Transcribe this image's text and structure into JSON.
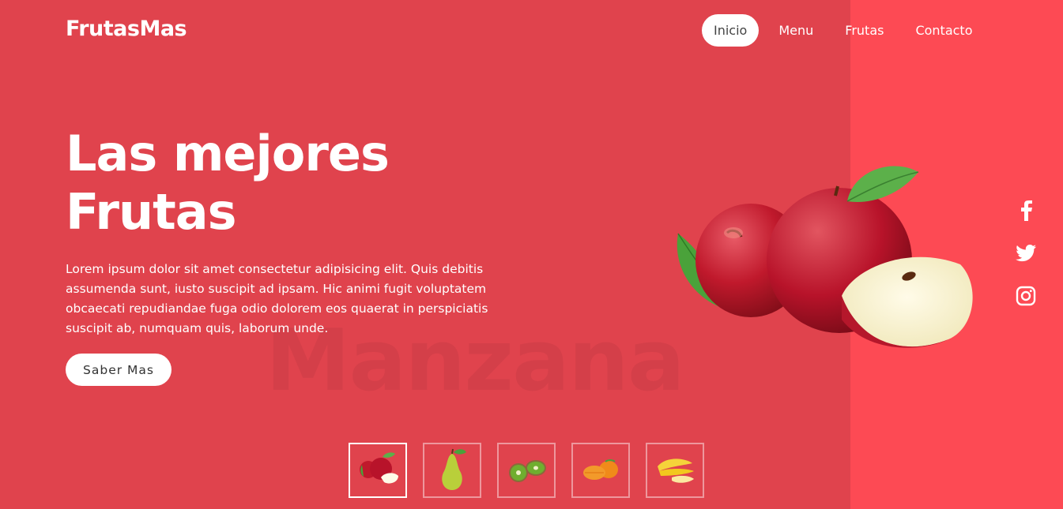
{
  "brand": {
    "logo_text": "FrutasMas"
  },
  "nav": {
    "items": [
      {
        "label": "Inicio",
        "active": true
      },
      {
        "label": "Menu",
        "active": false
      },
      {
        "label": "Frutas",
        "active": false
      },
      {
        "label": "Contacto",
        "active": false
      }
    ]
  },
  "hero": {
    "title_line1": "Las mejores",
    "title_line2": "Frutas",
    "text": "Lorem ipsum dolor sit amet consectetur adipisicing elit. Quis debitis assumenda sunt, iusto suscipit ad ipsam. Hic animi fugit voluptatem obcaecati repudiandae fuga odio dolorem eos quaerat in perspiciatis suscipit ab, numquam quis, laborum unde.",
    "cta_label": "Saber Mas",
    "watermark": "Manzana",
    "image_icon": "apples-image"
  },
  "social": [
    {
      "icon": "facebook-icon"
    },
    {
      "icon": "twitter-icon"
    },
    {
      "icon": "instagram-icon"
    }
  ],
  "thumbnails": [
    {
      "icon": "apple-thumbnail",
      "active": true
    },
    {
      "icon": "pear-thumbnail",
      "active": false
    },
    {
      "icon": "kiwi-thumbnail",
      "active": false
    },
    {
      "icon": "orange-thumbnail",
      "active": false
    },
    {
      "icon": "banana-thumbnail",
      "active": false
    }
  ],
  "colors": {
    "background": "#e0434d",
    "accent_panel": "#fd4a54",
    "button_bg": "#ffffff",
    "text": "#ffffff"
  }
}
